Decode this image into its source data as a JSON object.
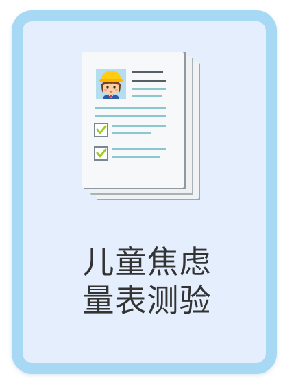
{
  "card": {
    "title_line1": "儿童焦虑",
    "title_line2": "量表测验",
    "icon": "questionnaire-document-icon",
    "colors": {
      "border": "#a7d8f4",
      "background": "#e4eefc",
      "text": "#333333",
      "check": "#9ccc1c"
    }
  }
}
